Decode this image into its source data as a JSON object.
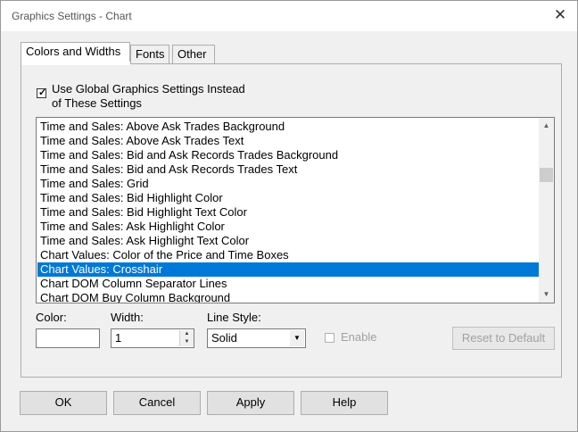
{
  "window": {
    "title": "Graphics Settings - Chart"
  },
  "tabs": [
    {
      "label": "Colors and Widths",
      "active": true
    },
    {
      "label": "Fonts",
      "active": false
    },
    {
      "label": "Other",
      "active": false
    }
  ],
  "global_checkbox": {
    "checked": true,
    "line1": "Use Global Graphics Settings Instead",
    "line2": "of These Settings"
  },
  "list": {
    "items": [
      "Time and Sales: Above Ask Trades Background",
      "Time and Sales: Above Ask Trades Text",
      "Time and Sales: Bid and Ask Records Trades Background",
      "Time and Sales: Bid and Ask Records Trades Text",
      "Time and Sales: Grid",
      "Time and Sales: Bid Highlight Color",
      "Time and Sales: Bid Highlight Text Color",
      "Time and Sales: Ask Highlight Color",
      "Time and Sales: Ask Highlight Text Color",
      "Chart Values: Color of the Price and Time Boxes",
      "Chart Values: Crosshair",
      "Chart DOM Column Separator Lines",
      "Chart DOM Buy Column Background"
    ],
    "selected_index": 10
  },
  "fields": {
    "color_label": "Color:",
    "color_value": "#ffffff",
    "width_label": "Width:",
    "width_value": "1",
    "line_style_label": "Line Style:",
    "line_style_value": "Solid",
    "enable_label": "Enable",
    "enable_checked": false,
    "reset_label": "Reset to Default"
  },
  "buttons": {
    "ok": "OK",
    "cancel": "Cancel",
    "apply": "Apply",
    "help": "Help"
  },
  "colors": {
    "selection": "#0078d7",
    "window_bg": "#f0f0f0"
  }
}
